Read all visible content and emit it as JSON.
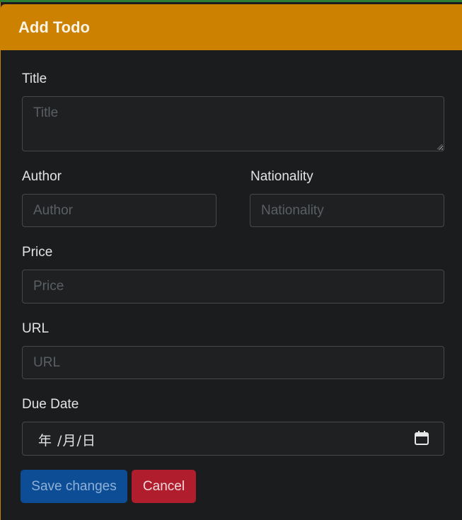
{
  "modal": {
    "title": "Add Todo"
  },
  "form": {
    "title": {
      "label": "Title",
      "placeholder": "Title",
      "value": ""
    },
    "author": {
      "label": "Author",
      "placeholder": "Author",
      "value": ""
    },
    "nationality": {
      "label": "Nationality",
      "placeholder": "Nationality",
      "value": ""
    },
    "price": {
      "label": "Price",
      "placeholder": "Price",
      "value": ""
    },
    "url": {
      "label": "URL",
      "placeholder": "URL",
      "value": ""
    },
    "due_date": {
      "label": "Due Date",
      "display": "年 /月/日"
    }
  },
  "buttons": {
    "save_label": "Save changes",
    "cancel_label": "Cancel"
  },
  "icons": {
    "date_picker": "calendar-icon",
    "textarea_resize": "resize-grip-icon"
  },
  "colors": {
    "header": "#cc8100",
    "primary": "#0d4d95",
    "danger": "#b01d2d",
    "background": "#1b1c1e"
  }
}
